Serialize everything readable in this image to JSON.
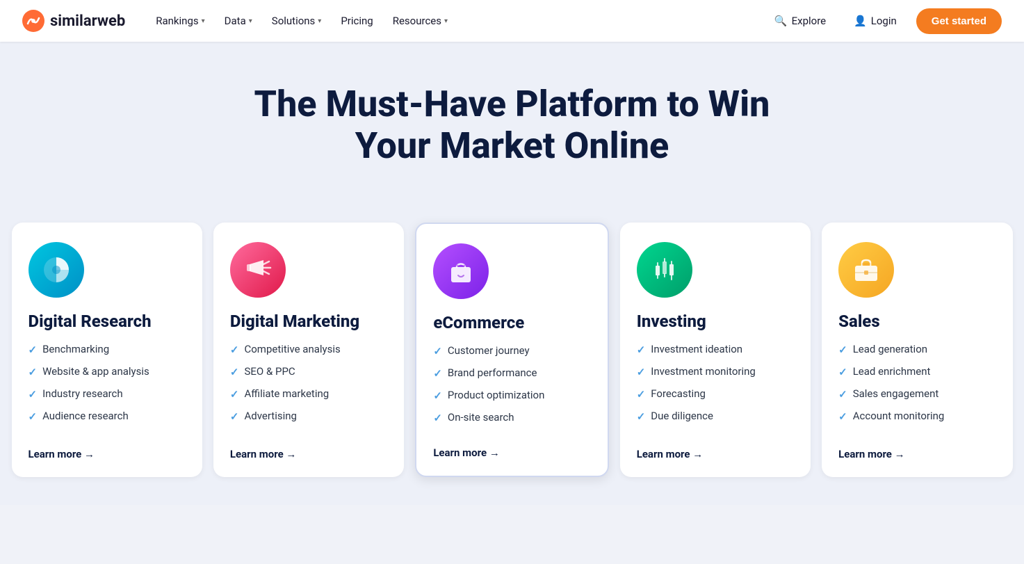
{
  "nav": {
    "logo_text": "similarweb",
    "items": [
      {
        "label": "Rankings",
        "has_dropdown": true
      },
      {
        "label": "Data",
        "has_dropdown": true
      },
      {
        "label": "Solutions",
        "has_dropdown": true
      },
      {
        "label": "Pricing",
        "has_dropdown": false
      },
      {
        "label": "Resources",
        "has_dropdown": true
      }
    ],
    "explore_label": "Explore",
    "login_label": "Login",
    "cta_label": "Get started"
  },
  "hero": {
    "title": "The Must-Have Platform to Win Your Market Online"
  },
  "cards": [
    {
      "id": "digital-research",
      "icon_class": "icon-digital-research",
      "icon_symbol": "🔵",
      "title": "Digital Research",
      "highlighted": false,
      "items": [
        "Benchmarking",
        "Website & app analysis",
        "Industry research",
        "Audience research"
      ],
      "learn_more": "Learn more →"
    },
    {
      "id": "digital-marketing",
      "icon_class": "icon-digital-marketing",
      "icon_symbol": "📣",
      "title": "Digital Marketing",
      "highlighted": false,
      "items": [
        "Competitive analysis",
        "SEO & PPC",
        "Affiliate marketing",
        "Advertising"
      ],
      "learn_more": "Learn more →"
    },
    {
      "id": "ecommerce",
      "icon_class": "icon-ecommerce",
      "icon_symbol": "🛍️",
      "title": "eCommerce",
      "highlighted": true,
      "items": [
        "Customer journey",
        "Brand performance",
        "Product optimization",
        "On-site search"
      ],
      "learn_more": "Learn more →"
    },
    {
      "id": "investing",
      "icon_class": "icon-investing",
      "icon_symbol": "📈",
      "title": "Investing",
      "highlighted": false,
      "items": [
        "Investment ideation",
        "Investment monitoring",
        "Forecasting",
        "Due diligence"
      ],
      "learn_more": "Learn more →"
    },
    {
      "id": "sales",
      "icon_class": "icon-sales",
      "icon_symbol": "💼",
      "title": "Sales",
      "highlighted": false,
      "items": [
        "Lead generation",
        "Lead enrichment",
        "Sales engagement",
        "Account monitoring"
      ],
      "learn_more": "Learn more →"
    }
  ]
}
